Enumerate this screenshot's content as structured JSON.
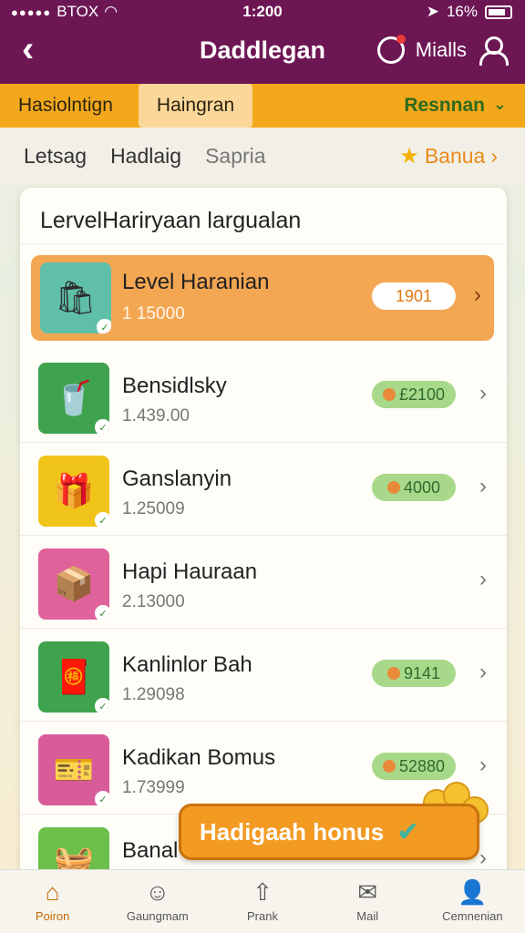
{
  "status_bar": {
    "dots": "●●●●●",
    "carrier": "BTOX",
    "time": "1:200",
    "battery": "16%"
  },
  "header": {
    "back_icon": "chevron-left-icon",
    "title": "Daddlegan",
    "right_label": "Mialls"
  },
  "tabs": [
    {
      "label": "Hasiolntign"
    },
    {
      "label": "Haingran"
    },
    {
      "label": "Resnnan"
    }
  ],
  "subnav": {
    "items": [
      "Letsag",
      "Hadlaig",
      "Sapria"
    ],
    "bonus": "Banua"
  },
  "list": {
    "title": "LervelHariryaan largualan",
    "items": [
      {
        "name": "Level Haranian",
        "value": "1 15000",
        "pill": "1901",
        "icon": "shopping-bag-icon",
        "color": "#5fbfa9"
      },
      {
        "name": "Bensidlsky",
        "value": "1.439.00",
        "pill": "£2100",
        "icon": "drink-cup-icon",
        "color": "#3fa34d"
      },
      {
        "name": "Ganslanyin",
        "value": "1.25009",
        "pill": "4000",
        "icon": "gift-box-icon",
        "color": "#f0c419"
      },
      {
        "name": "Hapi Hauraan",
        "value": "2.13000",
        "pill": "",
        "icon": "package-icon",
        "color": "#e0629a"
      },
      {
        "name": "Kanlinlor Bah",
        "value": "1.29098",
        "pill": "9141",
        "icon": "red-envelope-icon",
        "color": "#3fa34d"
      },
      {
        "name": "Kadikan Bomus",
        "value": "1.73999",
        "pill": "52880",
        "icon": "coupon-box-icon",
        "color": "#d85b9a"
      },
      {
        "name": "Banal",
        "value": "",
        "pill": "",
        "icon": "basket-icon",
        "color": "#6bbf4a"
      }
    ]
  },
  "floating_button": {
    "label": "Hadigaah honus"
  },
  "bottom_nav": [
    {
      "label": "Poiron",
      "icon": "home-icon"
    },
    {
      "label": "Gaungmam",
      "icon": "face-icon"
    },
    {
      "label": "Prank",
      "icon": "arrow-up-icon"
    },
    {
      "label": "Mail",
      "icon": "mail-icon"
    },
    {
      "label": "Cemnenian",
      "icon": "profile-icon"
    }
  ]
}
